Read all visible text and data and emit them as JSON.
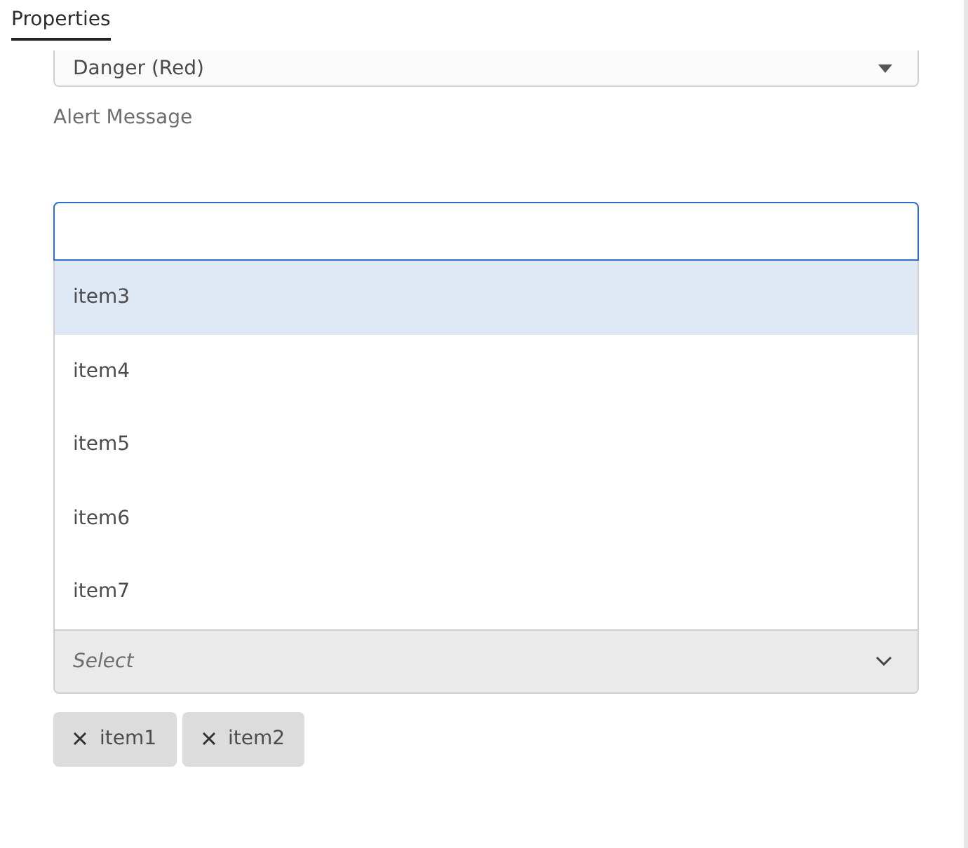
{
  "header": {
    "title": "Properties"
  },
  "type_select": {
    "value": "Danger (Red)"
  },
  "alert_message": {
    "label": "Alert Message"
  },
  "options": [
    {
      "label": "item3",
      "selected": true
    },
    {
      "label": "item4",
      "selected": false
    },
    {
      "label": "item5",
      "selected": false
    },
    {
      "label": "item6",
      "selected": false
    },
    {
      "label": "item7",
      "selected": false
    }
  ],
  "multi_select": {
    "placeholder": "Select"
  },
  "tags": [
    {
      "label": "item1"
    },
    {
      "label": "item2"
    }
  ]
}
